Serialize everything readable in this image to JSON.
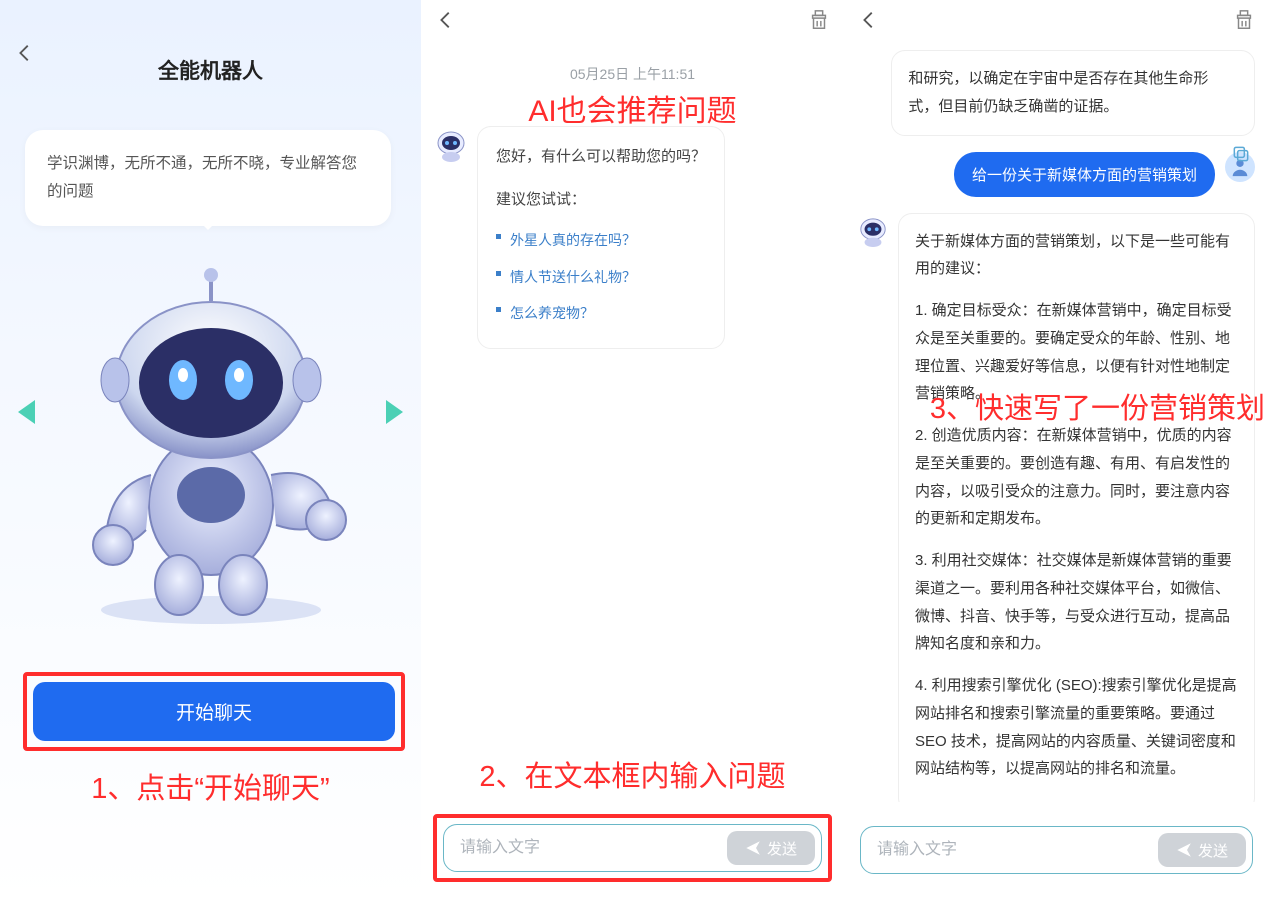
{
  "panel1": {
    "title": "全能机器人",
    "intro": "学识渊博，无所不通，无所不晓，专业解答您的问题",
    "start_button": "开始聊天",
    "caption": "1、点击“开始聊天”"
  },
  "panel2": {
    "timestamp": "05月25日  上午11:51",
    "annot_top": "AI也会推荐问题",
    "greeting": "您好，有什么可以帮助您的吗？",
    "suggest_title": "建议您试试：",
    "suggestions": {
      "0": "外星人真的存在吗？",
      "1": "情人节送什么礼物？",
      "2": "怎么养宠物？"
    },
    "caption": "2、在文本框内输入问题",
    "input_placeholder": "请输入文字",
    "send_label": "发送"
  },
  "panel3": {
    "bot_reply_top": "和研究，以确定在宇宙中是否存在其他生命形式，但目前仍缺乏确凿的证据。",
    "user_msg": "给一份关于新媒体方面的营销策划",
    "caption": "3、快速写了一份营销策划",
    "bot_reply2_intro": "关于新媒体方面的营销策划，以下是一些可能有用的建议：",
    "bot_reply2_1": "1. 确定目标受众：在新媒体营销中，确定目标受众是至关重要的。要确定受众的年龄、性别、地理位置、兴趣爱好等信息，以便有针对性地制定营销策略。",
    "bot_reply2_2": "2. 创造优质内容：在新媒体营销中，优质的内容是至关重要的。要创造有趣、有用、有启发性的内容，以吸引受众的注意力。同时，要注意内容的更新和定期发布。",
    "bot_reply2_3": "3. 利用社交媒体：社交媒体是新媒体营销的重要渠道之一。要利用各种社交媒体平台，如微信、微博、抖音、快手等，与受众进行互动，提高品牌知名度和亲和力。",
    "bot_reply2_4": "4. 利用搜索引擎优化 (SEO):搜索引擎优化是提高网站排名和搜索引擎流量的重要策略。要通过 SEO 技术，提高网站的内容质量、关键词密度和网站结构等，以提高网站的排名和流量。",
    "input_placeholder": "请输入文字",
    "send_label": "发送"
  }
}
